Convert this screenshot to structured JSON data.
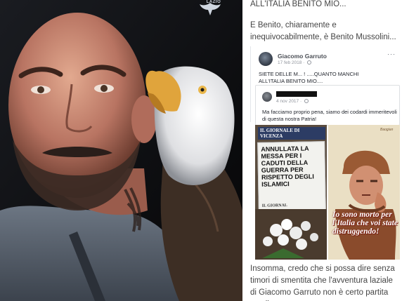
{
  "crest": {
    "label": "LAZIO"
  },
  "article": {
    "top_line": "ALL'ITALIA BENITO MIO...",
    "intro": "E Benito, chiaramente e inequivocabilmente, è Benito Mussolini...",
    "post": {
      "author": "Giacomo Garruto",
      "date": "17 feb 2018 ·",
      "text_line1": "SIETE DELLE M...        ! .....QUANTO MANCHI",
      "text_line2": "ALL'ITALIA BENITO MIO....",
      "more_label": "···",
      "shared": {
        "date": "4 nov 2017 ·",
        "text": "Ma facciamo proprio pena, siamo dei codardi immeritevoli di questa nostra Patria!"
      },
      "images": {
        "newspaper_masthead": "IL GIORNALE DI VICENZA",
        "newspaper_headline": "ANNULLATA LA MESSA PER I CADUTI DELLA GUERRA PER RISPETTO DEGLI ISLAMICI",
        "newspaper_footer": "IL GIORNAL",
        "poster_text": "Io sono morto per l'Italia che voi state distruggendo!",
        "poster_signature": "Baogian"
      }
    },
    "closing": "Insomma, credo che si possa dire senza timori di smentita che l'avventura laziale di Giacomo Garruto non è certo partita con il"
  }
}
